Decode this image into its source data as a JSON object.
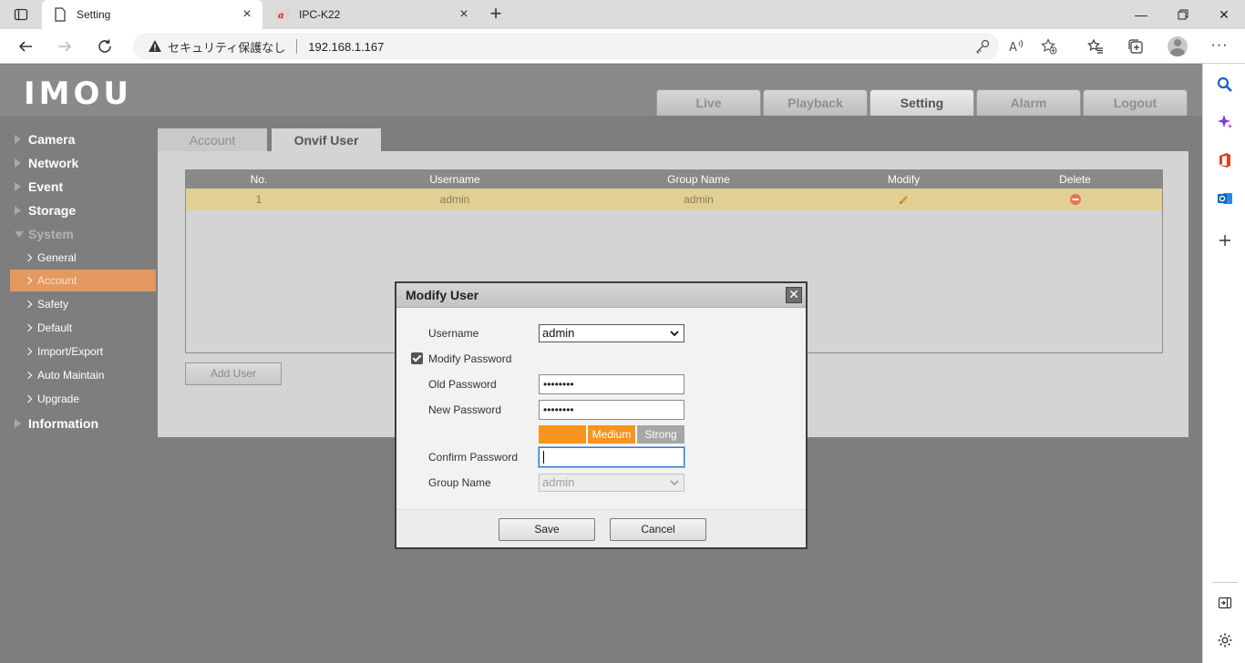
{
  "browser": {
    "tabs": [
      {
        "title": "Setting"
      },
      {
        "title": "IPC-K22"
      }
    ],
    "security_label": "セキュリティ保護なし",
    "url": "192.168.1.167"
  },
  "app": {
    "logo": "IMOU",
    "main_tabs": [
      "Live",
      "Playback",
      "Setting",
      "Alarm",
      "Logout"
    ],
    "nav": {
      "camera": "Camera",
      "network": "Network",
      "event": "Event",
      "storage": "Storage",
      "system": "System",
      "sub": [
        "General",
        "Account",
        "Safety",
        "Default",
        "Import/Export",
        "Auto Maintain",
        "Upgrade"
      ],
      "information": "Information"
    },
    "content_tabs": [
      "Account",
      "Onvif User"
    ],
    "table": {
      "headers": [
        "No.",
        "Username",
        "Group Name",
        "Modify",
        "Delete"
      ],
      "rows": [
        {
          "no": "1",
          "username": "admin",
          "group": "admin"
        }
      ]
    },
    "add_user": "Add User"
  },
  "modal": {
    "title": "Modify User",
    "username_label": "Username",
    "username_value": "admin",
    "modify_password_label": "Modify Password",
    "old_password_label": "Old Password",
    "old_password_value": "••••••••",
    "new_password_label": "New Password",
    "new_password_value": "••••••••",
    "strength": {
      "medium": "Medium",
      "strong": "Strong"
    },
    "confirm_password_label": "Confirm Password",
    "group_name_label": "Group Name",
    "group_name_value": "admin",
    "save": "Save",
    "cancel": "Cancel"
  },
  "colors": {
    "accent_orange": "#f7941d",
    "nav_active": "#e39960",
    "row_highlight": "#e1cf94"
  }
}
